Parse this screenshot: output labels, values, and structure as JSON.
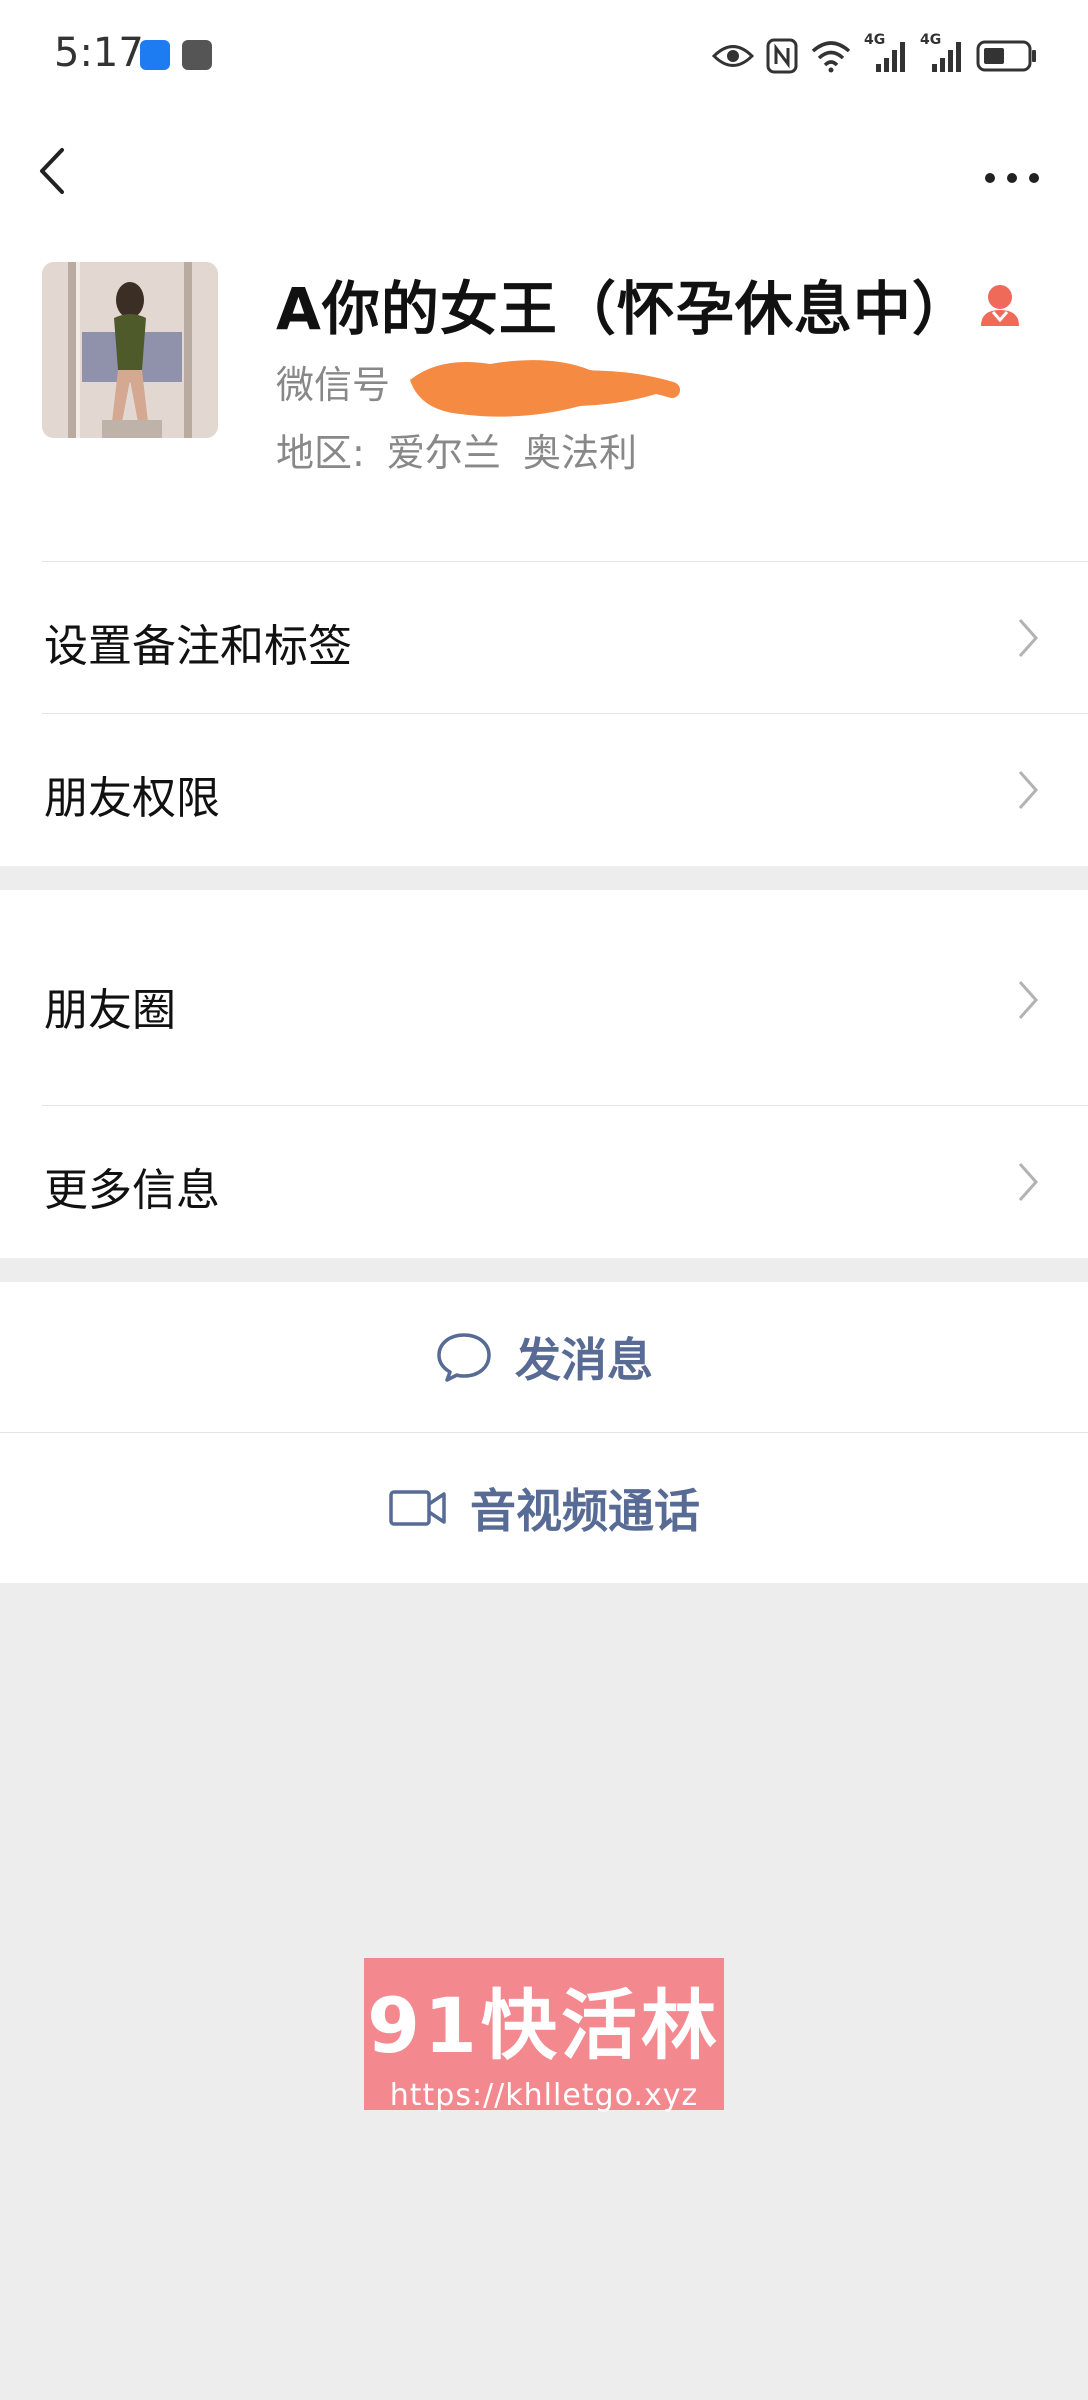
{
  "status_bar": {
    "time": "5:17",
    "signal1_label": "4G",
    "signal2_label": "4G",
    "icons": [
      "shield-app-icon",
      "huawei-app-icon",
      "eye-icon",
      "nfc-icon",
      "wifi-icon",
      "signal-icon",
      "signal-icon",
      "battery-icon"
    ]
  },
  "nav": {
    "back_icon": "chevron-left-icon",
    "more_icon": "more-dots-icon"
  },
  "profile": {
    "name": "A你的女王（怀孕休息中）",
    "gender_icon": "female-user-icon",
    "wechat_id_label": "微信号",
    "region_label": "地区:",
    "region_country": "爱尔兰",
    "region_city": "奥法利"
  },
  "cells": {
    "remarks_tags": "设置备注和标签",
    "friend_permissions": "朋友权限",
    "moments": "朋友圈",
    "more_info": "更多信息"
  },
  "actions": {
    "message": "发消息",
    "av_call": "音视频通话"
  },
  "watermark": {
    "title": "91快活林",
    "url": "https://khlletgo.xyz"
  },
  "colors": {
    "link_blue": "#576b95",
    "page_bg": "#ededed",
    "watermark_bg": "#f3888f",
    "scribble": "#f58a42",
    "gender_icon": "#f06a5a"
  }
}
